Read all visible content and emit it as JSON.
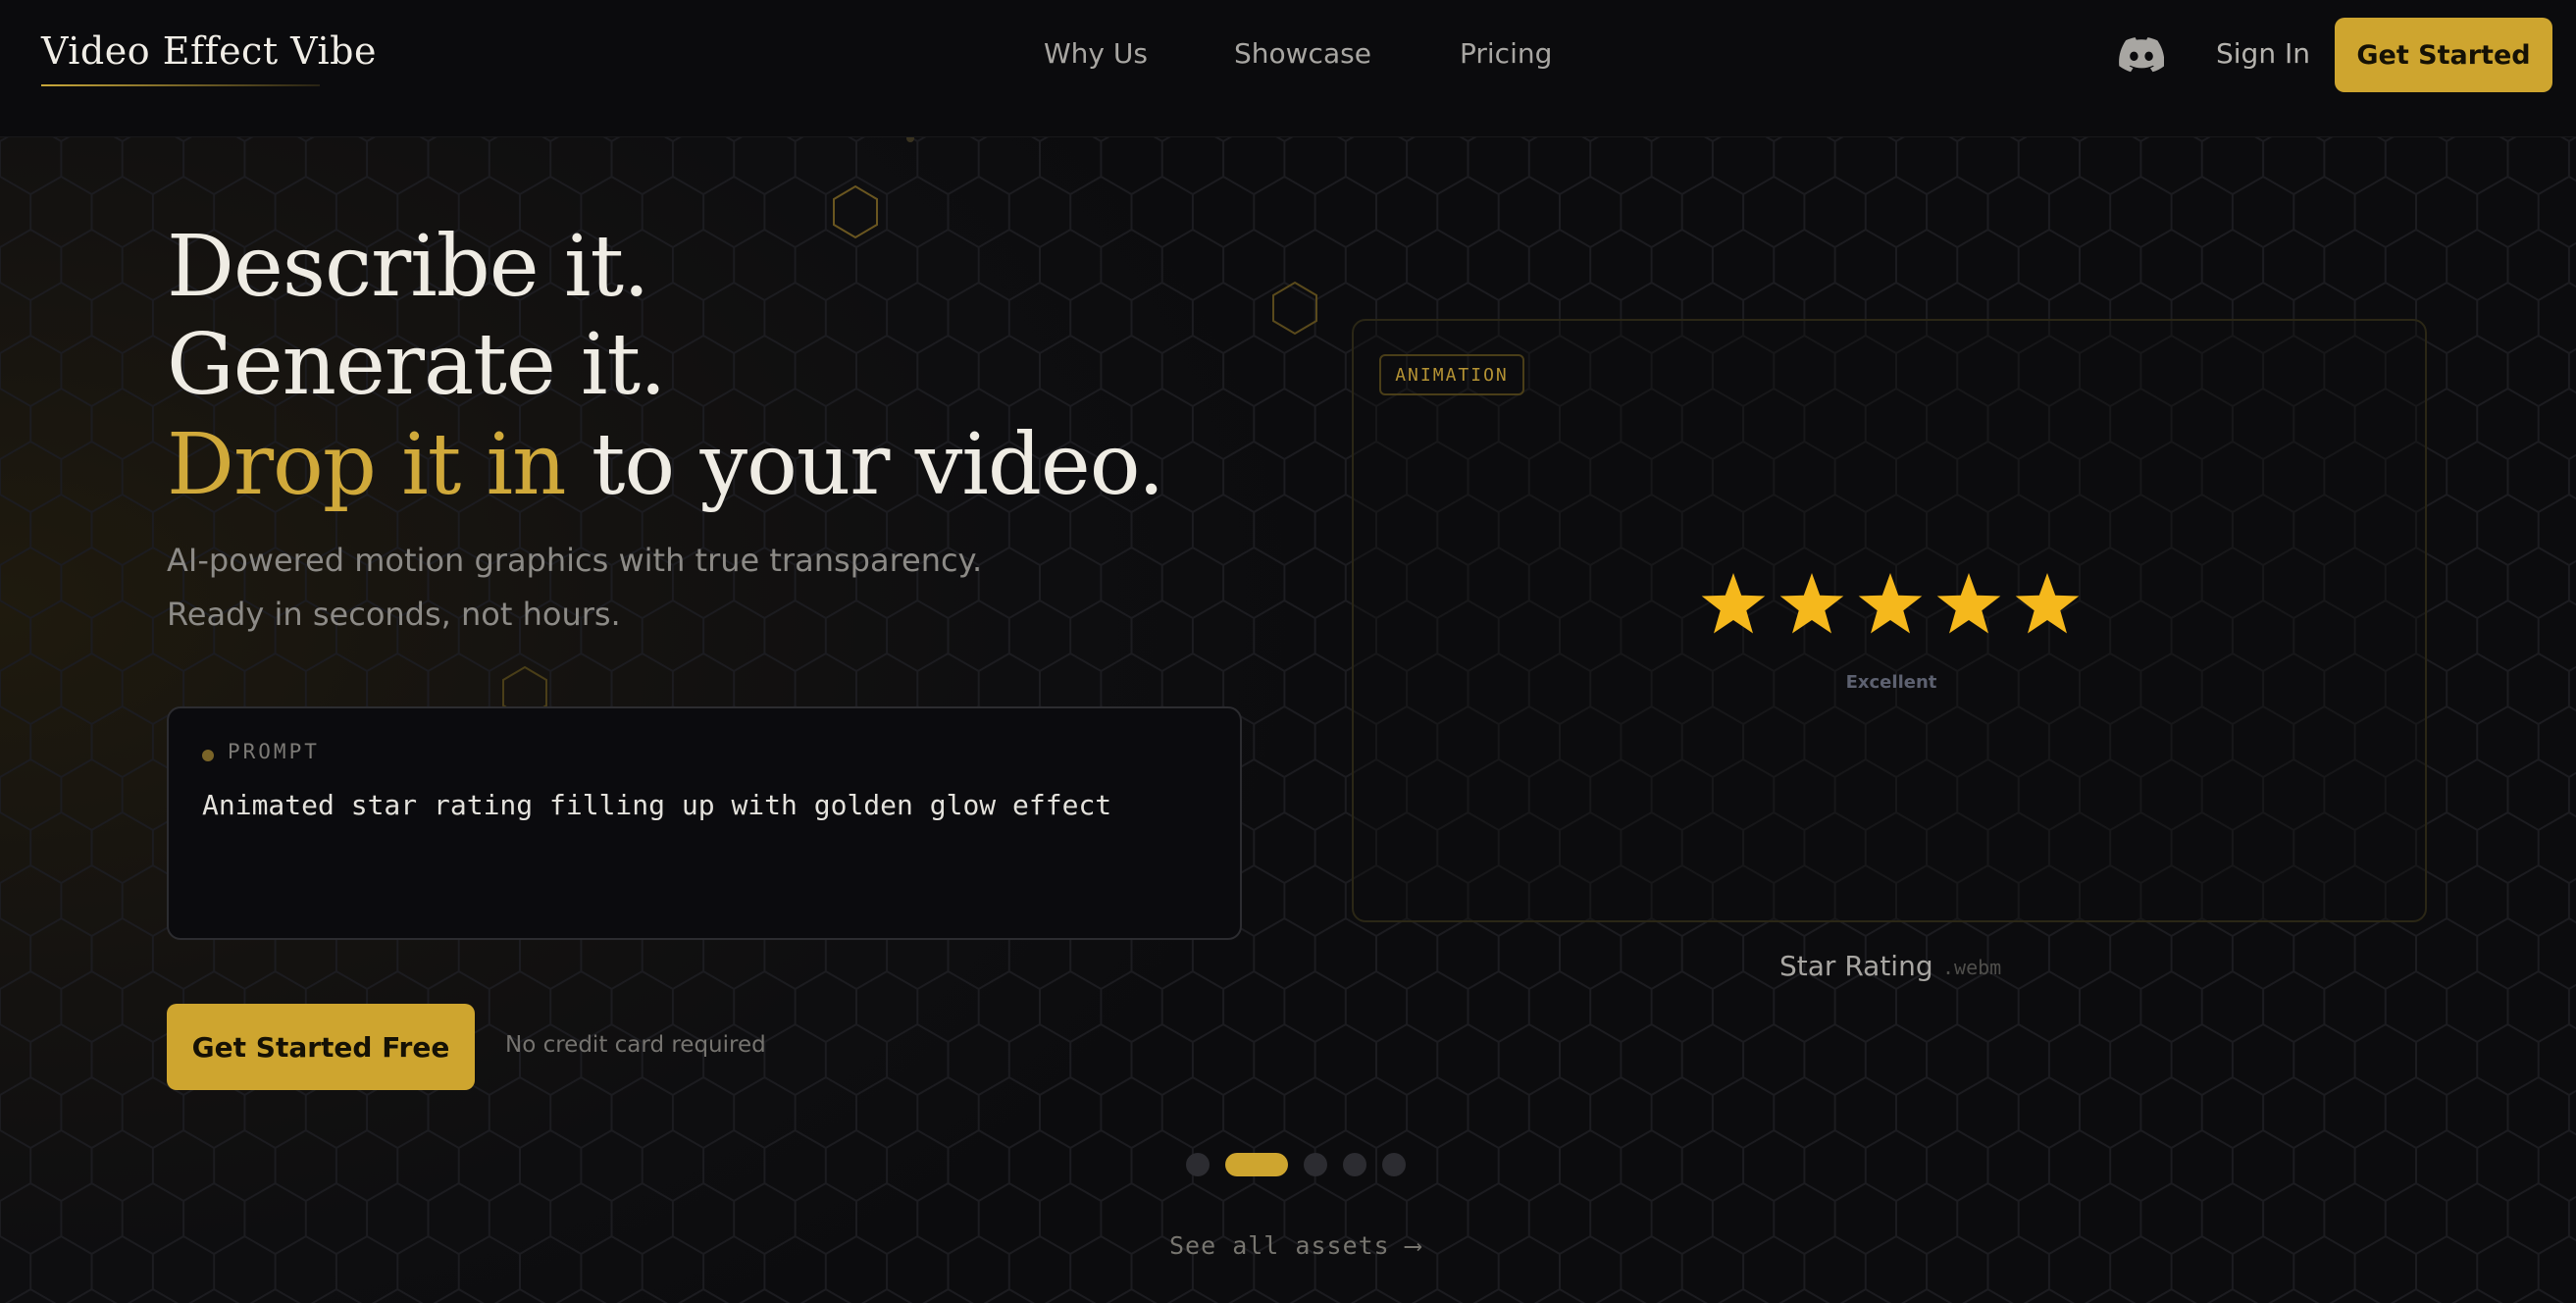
{
  "nav": {
    "logo": "Video Effect Vibe",
    "links": [
      "Why Us",
      "Showcase",
      "Pricing"
    ],
    "discord_icon": "discord-icon",
    "sign_in": "Sign In",
    "cta": "Get Started"
  },
  "hero": {
    "line1": "Describe it.",
    "line2": "Generate it.",
    "line3_highlight": "Drop it in",
    "line3_rest": " to your video.",
    "sub1": "AI-powered motion graphics with true transparency.",
    "sub2": "Ready in seconds, not hours.",
    "prompt_label": "PROMPT",
    "prompt_text": "Animated star rating filling up with golden glow effect",
    "cta": "Get Started Free",
    "note": "No credit card required"
  },
  "preview": {
    "badge": "ANIMATION",
    "rating_label": "Excellent",
    "star_count": 5,
    "star_color": "#f5b81c",
    "asset_name": "Star Rating",
    "asset_ext": ".webm"
  },
  "carousel": {
    "slides": 5,
    "active_index": 1,
    "see_all": "See all assets ⟶"
  },
  "colors": {
    "accent": "#cea52f",
    "background": "#0d0d0f"
  }
}
